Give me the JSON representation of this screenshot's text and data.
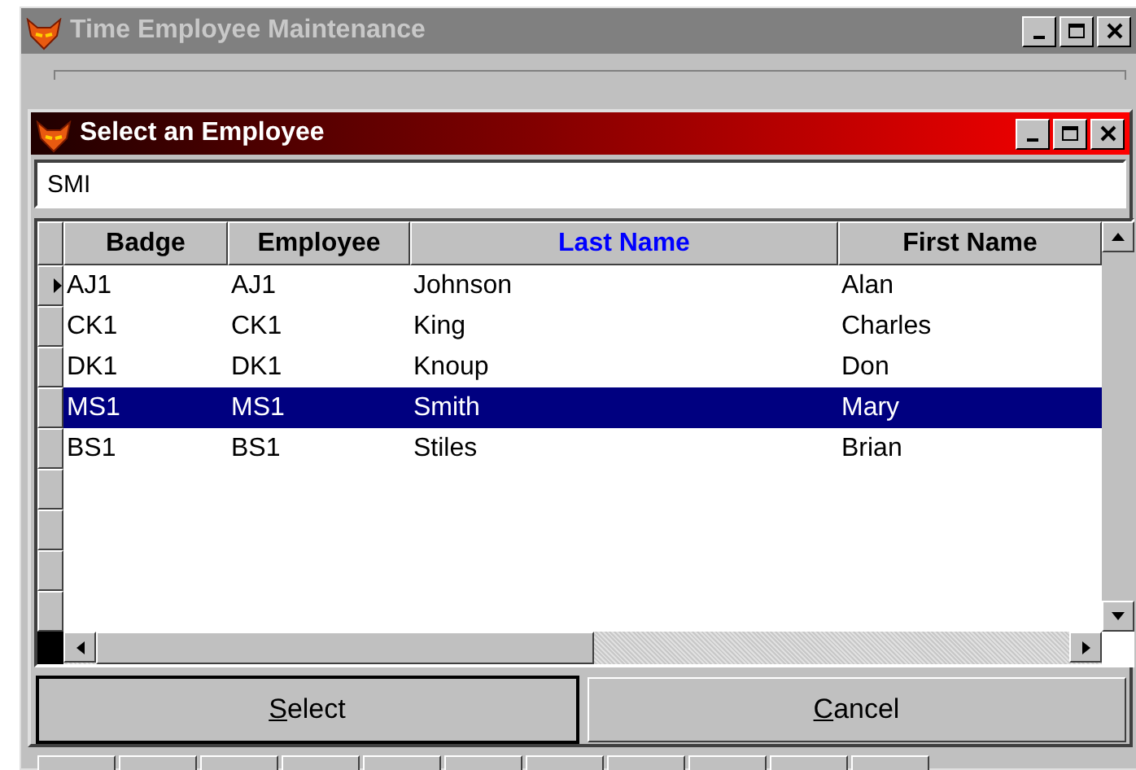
{
  "background_window": {
    "title": "Time Employee Maintenance",
    "active": false
  },
  "dialog": {
    "title": "Select an Employee",
    "active": true
  },
  "search": {
    "value": "SMI"
  },
  "table": {
    "columns": [
      {
        "label": "Badge",
        "sorted": false
      },
      {
        "label": "Employee",
        "sorted": false
      },
      {
        "label": "Last Name",
        "sorted": true
      },
      {
        "label": "First Name",
        "sorted": false
      }
    ],
    "rows": [
      {
        "cells": [
          "AJ1",
          "AJ1",
          "Johnson",
          "Alan"
        ],
        "current": true,
        "selected": false
      },
      {
        "cells": [
          "CK1",
          "CK1",
          "King",
          "Charles"
        ],
        "current": false,
        "selected": false
      },
      {
        "cells": [
          "DK1",
          "DK1",
          "Knoup",
          "Don"
        ],
        "current": false,
        "selected": false
      },
      {
        "cells": [
          "MS1",
          "MS1",
          "Smith",
          "Mary"
        ],
        "current": false,
        "selected": true
      },
      {
        "cells": [
          "BS1",
          "BS1",
          "Stiles",
          "Brian"
        ],
        "current": false,
        "selected": false
      }
    ]
  },
  "buttons": [
    {
      "label": "Select",
      "underline_first": true,
      "default": true
    },
    {
      "label": "Cancel",
      "underline_first": true,
      "default": false
    }
  ]
}
